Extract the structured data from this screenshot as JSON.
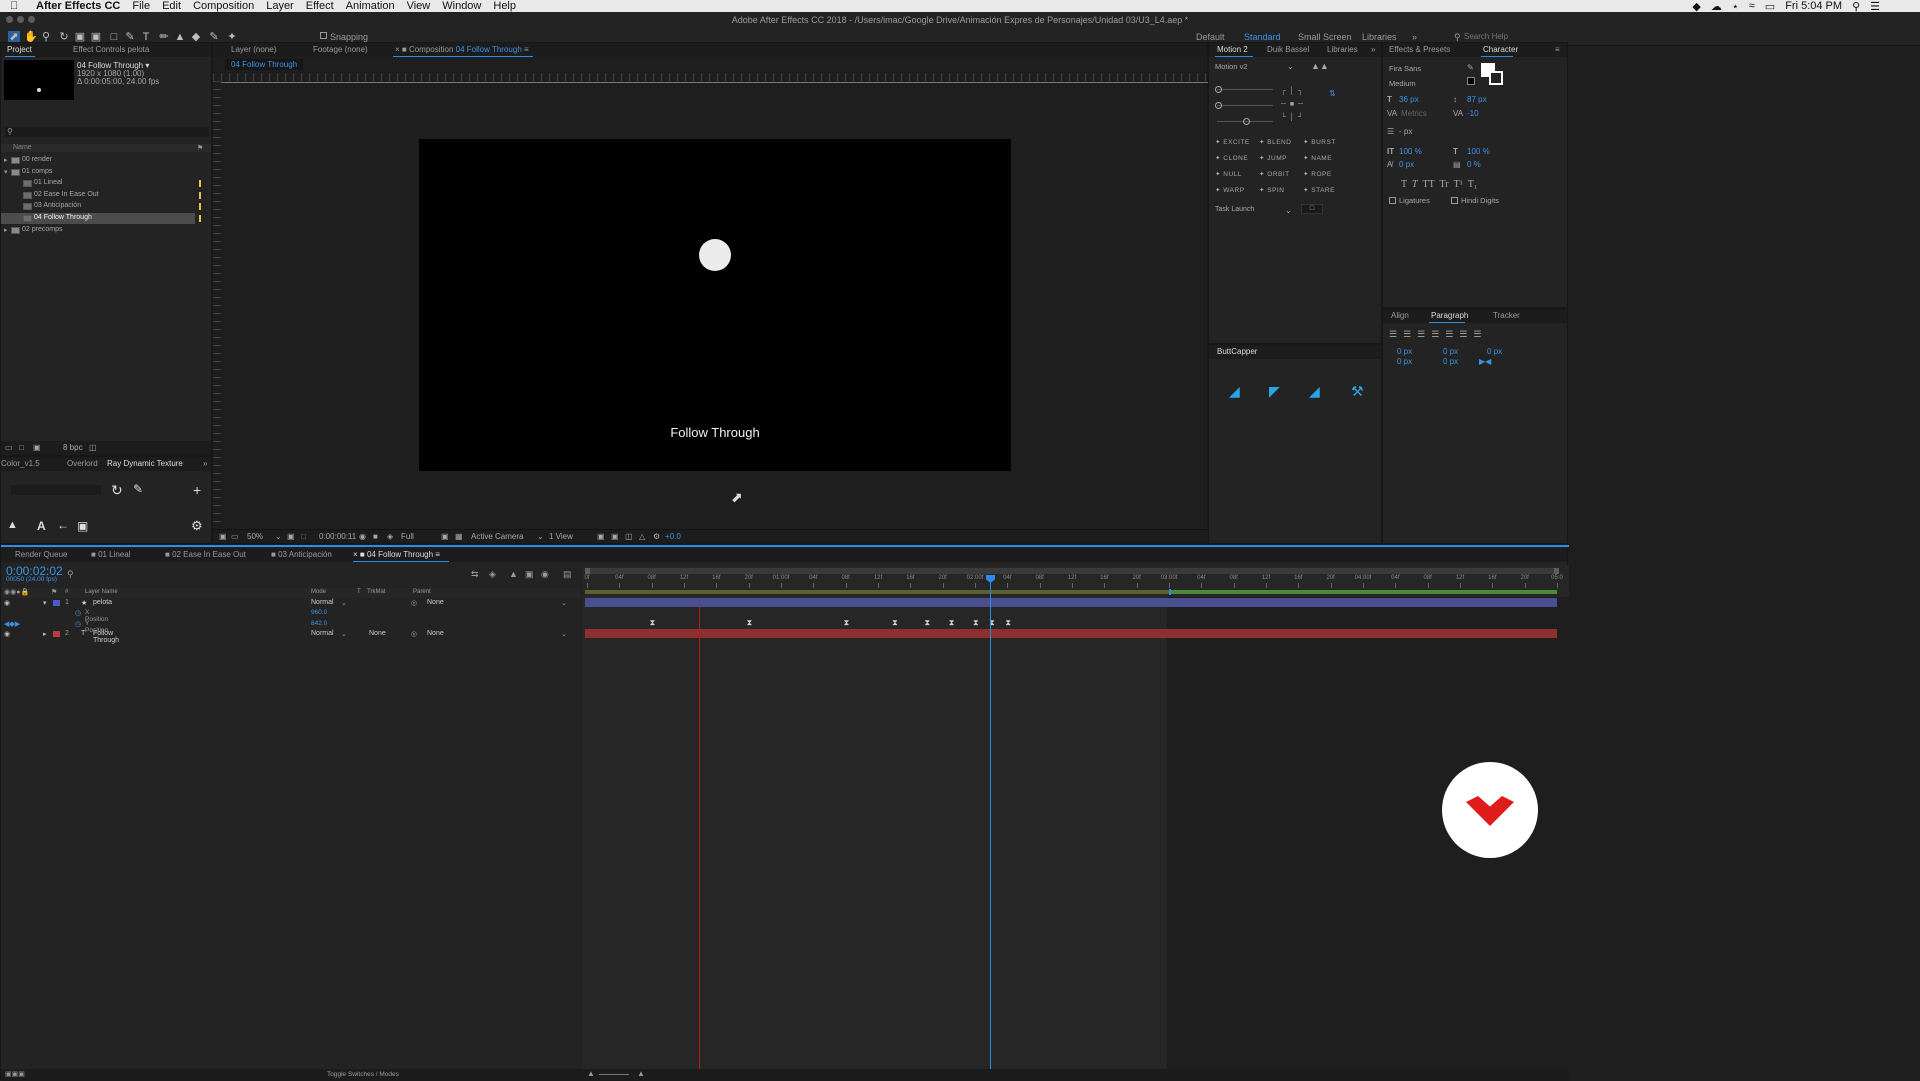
{
  "menubar": {
    "app_name": "After Effects CC",
    "items": [
      "File",
      "Edit",
      "Composition",
      "Layer",
      "Effect",
      "Animation",
      "View",
      "Window",
      "Help"
    ],
    "clock": "Fri 5:04 PM"
  },
  "titlebar": {
    "title": "Adobe After Effects CC 2018 - /Users/imac/Google Drive/Animación Expres de Personajes/Unidad 03/U3_L4.aep *"
  },
  "toolbar": {
    "snapping": "Snapping",
    "workspaces": [
      "Default",
      "Standard",
      "Small Screen",
      "Libraries"
    ],
    "active_workspace": "Standard",
    "search_placeholder": "Search Help"
  },
  "project": {
    "tabs": [
      "Project",
      "Effect Controls pelota"
    ],
    "comp_name": "04 Follow Through ▾",
    "comp_res": "1920 x 1080 (1.00)",
    "comp_duration": "Δ 0:00:05:00, 24.00 fps",
    "column_name": "Name",
    "items": [
      {
        "label": "00 render",
        "type": "folder",
        "expanded": false,
        "indent": 0
      },
      {
        "label": "01 comps",
        "type": "folder",
        "expanded": true,
        "indent": 0
      },
      {
        "label": "01 Lineal",
        "type": "comp",
        "indent": 1
      },
      {
        "label": "02 Ease In Ease Out",
        "type": "comp",
        "indent": 1
      },
      {
        "label": "03 Anticipación",
        "type": "comp",
        "indent": 1
      },
      {
        "label": "04 Follow Through",
        "type": "comp",
        "indent": 1,
        "selected": true
      },
      {
        "label": "02 precomps",
        "type": "folder",
        "expanded": false,
        "indent": 0
      }
    ],
    "bpc": "8 bpc"
  },
  "tools_panel": {
    "tabs": [
      "Color_v1.5",
      "Overlord",
      "Ray Dynamic Texture"
    ]
  },
  "viewer": {
    "tabs": [
      "Layer (none)",
      "Footage (none)",
      "Composition 04 Follow Through"
    ],
    "active_tab_prefix": "Composition",
    "active_tab_name": "04 Follow Through",
    "breadcrumb": "04 Follow Through",
    "comp_text": "Follow Through",
    "footer": {
      "zoom": "50%",
      "timecode": "0:00:00:11",
      "resolution": "Full",
      "camera": "Active Camera",
      "views": "1 View",
      "exposure": "+0.0"
    }
  },
  "motion": {
    "tabs": [
      "Motion 2",
      "Duik Bassel",
      "Libraries"
    ],
    "preset": "Motion v2",
    "buttons": [
      "EXCITE",
      "BLEND",
      "BURST",
      "CLONE",
      "JUMP",
      "NAME",
      "NULL",
      "ORBIT",
      "ROPE",
      "WARP",
      "SPIN",
      "STARE"
    ],
    "task": "Task Launch"
  },
  "buttcapper": {
    "title": "ButtCapper"
  },
  "character": {
    "tabs": [
      "Effects & Presets",
      "Character"
    ],
    "font": "Fira Sans",
    "style": "Medium",
    "size": "36 px",
    "leading": "87 px",
    "kerning": "Metrics",
    "tracking": "-10",
    "stroke": "- px",
    "vscale": "100 %",
    "hscale": "100 %",
    "baseline": "0 px",
    "tsume": "0 %",
    "ligatures": "Ligatures",
    "hindi": "Hindi Digits"
  },
  "paragraph": {
    "tabs": [
      "Align",
      "Paragraph",
      "Tracker"
    ],
    "values": [
      "0 px",
      "0 px",
      "0 px",
      "0 px",
      "0 px"
    ]
  },
  "timeline": {
    "tabs": [
      "Render Queue",
      "01 Lineal",
      "02 Ease In Ease Out",
      "03 Anticipación",
      "04 Follow Through"
    ],
    "timecode": "0:00:02:02",
    "frame_info": "00050 (24.00 fps)",
    "columns": [
      "Layer Name",
      "Mode",
      "T",
      "TrkMat",
      "Parent"
    ],
    "layers": [
      {
        "num": "1",
        "name": "pelota",
        "mode": "Normal",
        "trkmat": "",
        "parent": "None",
        "color": "#4a5cc9"
      },
      {
        "num": "2",
        "name": "Follow Through",
        "mode": "Normal",
        "trkmat": "None",
        "parent": "None",
        "color": "#b83a3a"
      }
    ],
    "props": [
      {
        "name": "X Position",
        "value": "960.0"
      },
      {
        "name": "Y Position",
        "value": "842.0"
      }
    ],
    "ruler": [
      "0f",
      "04f",
      "08f",
      "12f",
      "16f",
      "20f",
      "01:00f",
      "04f",
      "08f",
      "12f",
      "16f",
      "20f",
      "02:00f",
      "04f",
      "08f",
      "12f",
      "16f",
      "20f",
      "03:00f",
      "04f",
      "08f",
      "12f",
      "16f",
      "20f",
      "04:00f",
      "04f",
      "08f",
      "12f",
      "16f",
      "20f",
      "05:0"
    ],
    "toggle": "Toggle Switches / Modes"
  },
  "colors": {
    "accent_blue": "#2d8ceb",
    "layer1_bar": "#4a4f8f",
    "layer2_bar": "#8d2f2f",
    "workarea": "#5a6a2a"
  }
}
